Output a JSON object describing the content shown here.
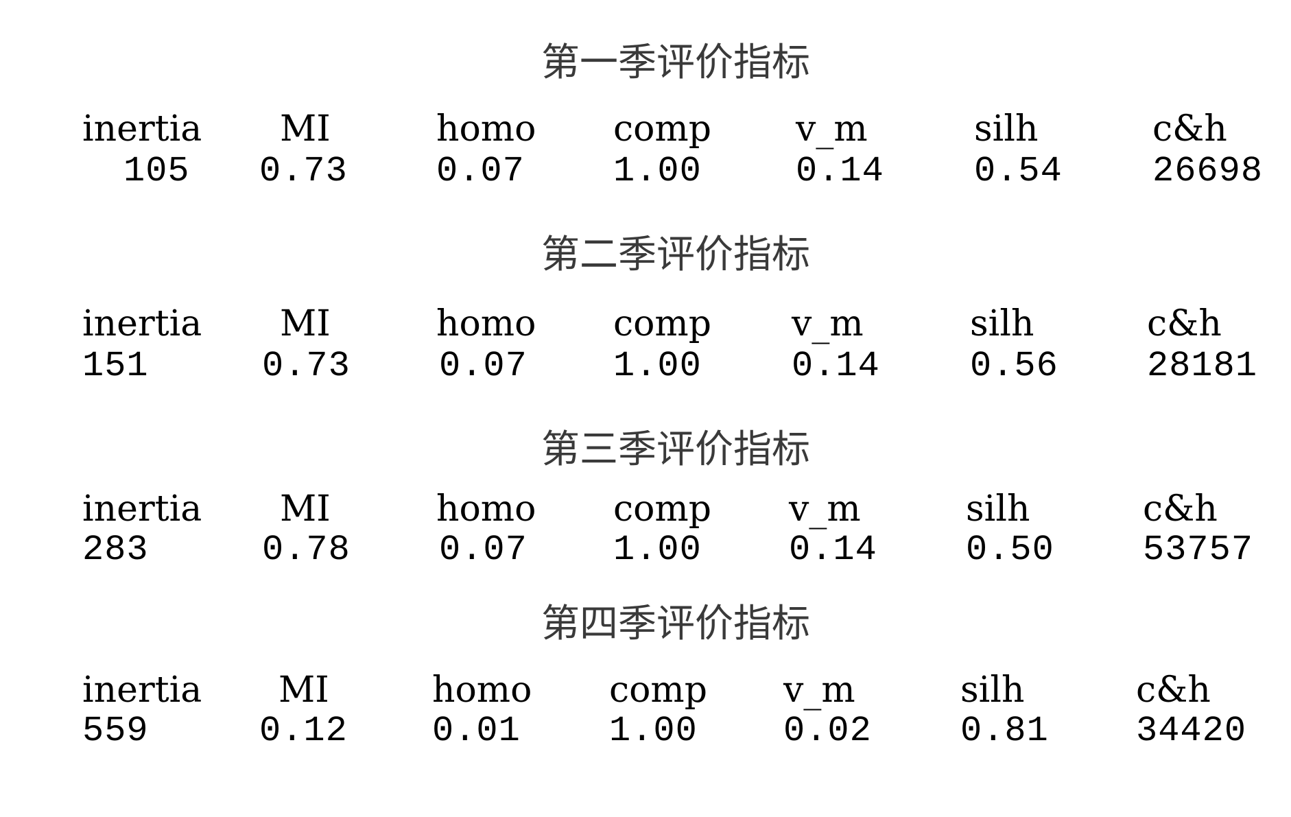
{
  "tables": [
    {
      "title": "第一季评价指标",
      "headers": [
        "inertia",
        "MI",
        "homo",
        "comp",
        "v_m",
        "silh",
        "c&h"
      ],
      "values": [
        "105",
        "0.73",
        "0.07",
        "1.00",
        "0.14",
        "0.54",
        "26698"
      ]
    },
    {
      "title": "第二季评价指标",
      "headers": [
        "inertia",
        "MI",
        "homo",
        "comp",
        "v_m",
        "silh",
        "c&h"
      ],
      "values": [
        "151",
        "0.73",
        "0.07",
        "1.00",
        "0.14",
        "0.56",
        "28181"
      ]
    },
    {
      "title": "第三季评价指标",
      "headers": [
        "inertia",
        "MI",
        "homo",
        "comp",
        "v_m",
        "silh",
        "c&h"
      ],
      "values": [
        "283",
        "0.78",
        "0.07",
        "1.00",
        "0.14",
        "0.50",
        "53757"
      ]
    },
    {
      "title": "第四季评价指标",
      "headers": [
        "inertia",
        "MI",
        "homo",
        "comp",
        "v_m",
        "silh",
        "c&h"
      ],
      "values": [
        "559",
        "0.12",
        "0.01",
        "1.00",
        "0.02",
        "0.81",
        "34420"
      ]
    }
  ]
}
